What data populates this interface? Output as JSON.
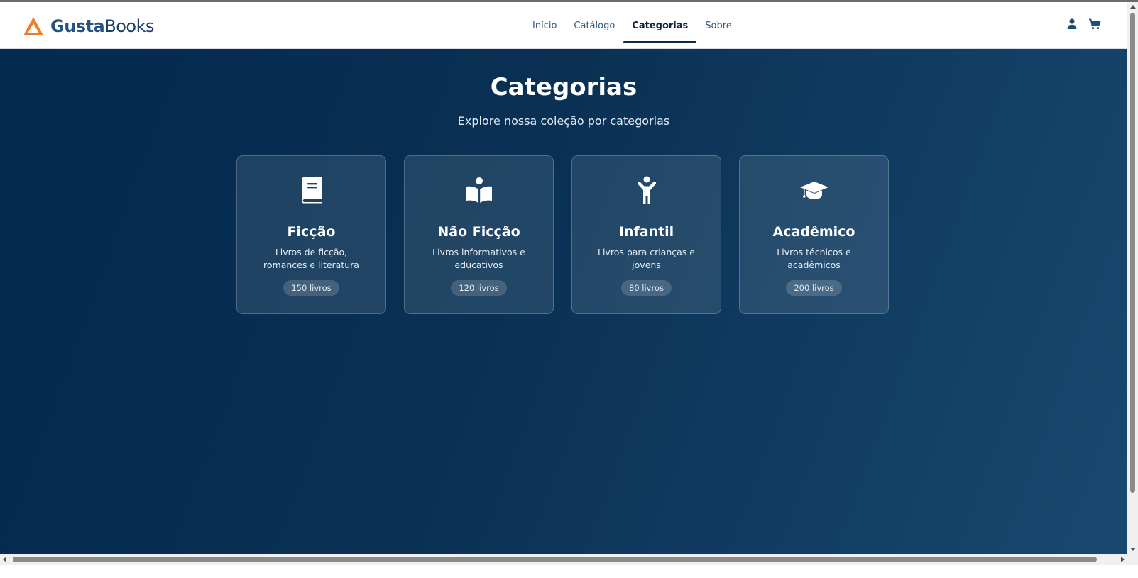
{
  "brand": {
    "name_bold": "Gusta",
    "name_light": "Books",
    "logo_icon": "triangle-logo-icon",
    "accent_color": "#f47b20"
  },
  "nav": {
    "items": [
      {
        "label": "Início",
        "active": false
      },
      {
        "label": "Catálogo",
        "active": false
      },
      {
        "label": "Categorias",
        "active": true
      },
      {
        "label": "Sobre",
        "active": false
      }
    ]
  },
  "header_icons": {
    "user": "user-icon",
    "cart": "cart-icon"
  },
  "page": {
    "title": "Categorias",
    "subtitle": "Explore nossa coleção por categorias"
  },
  "categories": [
    {
      "icon": "book-icon",
      "title": "Ficção",
      "description": "Livros de ficção, romances e literatura",
      "count": "150 livros"
    },
    {
      "icon": "reader-icon",
      "title": "Não Ficção",
      "description": "Livros informativos e educativos",
      "count": "120 livros"
    },
    {
      "icon": "child-icon",
      "title": "Infantil",
      "description": "Livros para crianças e jovens",
      "count": "80 livros"
    },
    {
      "icon": "graduation-cap-icon",
      "title": "Acadêmico",
      "description": "Livros técnicos e acadêmicos",
      "count": "200 livros"
    }
  ],
  "colors": {
    "background_start": "#032a4f",
    "background_end": "#184870",
    "header_bg": "#ffffff",
    "nav_active": "#0b2540"
  }
}
